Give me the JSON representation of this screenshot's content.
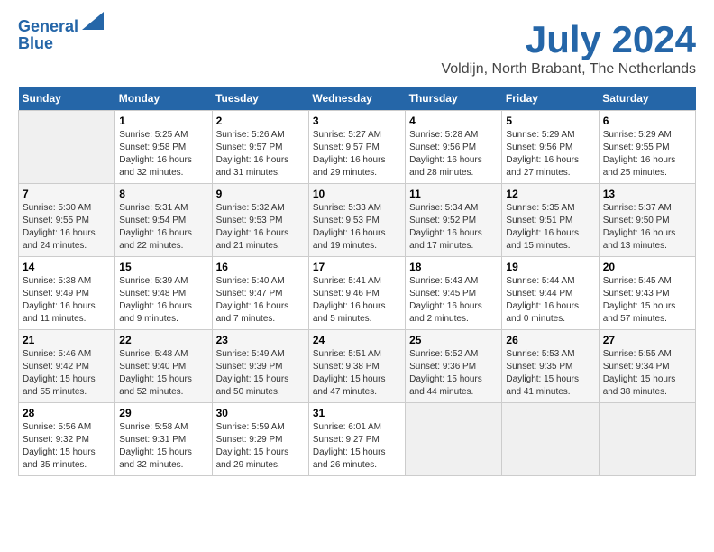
{
  "header": {
    "logo_line1": "General",
    "logo_line2": "Blue",
    "month_title": "July 2024",
    "location": "Voldijn, North Brabant, The Netherlands"
  },
  "calendar": {
    "days_of_week": [
      "Sunday",
      "Monday",
      "Tuesday",
      "Wednesday",
      "Thursday",
      "Friday",
      "Saturday"
    ],
    "weeks": [
      [
        {
          "day": "",
          "info": ""
        },
        {
          "day": "1",
          "info": "Sunrise: 5:25 AM\nSunset: 9:58 PM\nDaylight: 16 hours\nand 32 minutes."
        },
        {
          "day": "2",
          "info": "Sunrise: 5:26 AM\nSunset: 9:57 PM\nDaylight: 16 hours\nand 31 minutes."
        },
        {
          "day": "3",
          "info": "Sunrise: 5:27 AM\nSunset: 9:57 PM\nDaylight: 16 hours\nand 29 minutes."
        },
        {
          "day": "4",
          "info": "Sunrise: 5:28 AM\nSunset: 9:56 PM\nDaylight: 16 hours\nand 28 minutes."
        },
        {
          "day": "5",
          "info": "Sunrise: 5:29 AM\nSunset: 9:56 PM\nDaylight: 16 hours\nand 27 minutes."
        },
        {
          "day": "6",
          "info": "Sunrise: 5:29 AM\nSunset: 9:55 PM\nDaylight: 16 hours\nand 25 minutes."
        }
      ],
      [
        {
          "day": "7",
          "info": "Sunrise: 5:30 AM\nSunset: 9:55 PM\nDaylight: 16 hours\nand 24 minutes."
        },
        {
          "day": "8",
          "info": "Sunrise: 5:31 AM\nSunset: 9:54 PM\nDaylight: 16 hours\nand 22 minutes."
        },
        {
          "day": "9",
          "info": "Sunrise: 5:32 AM\nSunset: 9:53 PM\nDaylight: 16 hours\nand 21 minutes."
        },
        {
          "day": "10",
          "info": "Sunrise: 5:33 AM\nSunset: 9:53 PM\nDaylight: 16 hours\nand 19 minutes."
        },
        {
          "day": "11",
          "info": "Sunrise: 5:34 AM\nSunset: 9:52 PM\nDaylight: 16 hours\nand 17 minutes."
        },
        {
          "day": "12",
          "info": "Sunrise: 5:35 AM\nSunset: 9:51 PM\nDaylight: 16 hours\nand 15 minutes."
        },
        {
          "day": "13",
          "info": "Sunrise: 5:37 AM\nSunset: 9:50 PM\nDaylight: 16 hours\nand 13 minutes."
        }
      ],
      [
        {
          "day": "14",
          "info": "Sunrise: 5:38 AM\nSunset: 9:49 PM\nDaylight: 16 hours\nand 11 minutes."
        },
        {
          "day": "15",
          "info": "Sunrise: 5:39 AM\nSunset: 9:48 PM\nDaylight: 16 hours\nand 9 minutes."
        },
        {
          "day": "16",
          "info": "Sunrise: 5:40 AM\nSunset: 9:47 PM\nDaylight: 16 hours\nand 7 minutes."
        },
        {
          "day": "17",
          "info": "Sunrise: 5:41 AM\nSunset: 9:46 PM\nDaylight: 16 hours\nand 5 minutes."
        },
        {
          "day": "18",
          "info": "Sunrise: 5:43 AM\nSunset: 9:45 PM\nDaylight: 16 hours\nand 2 minutes."
        },
        {
          "day": "19",
          "info": "Sunrise: 5:44 AM\nSunset: 9:44 PM\nDaylight: 16 hours\nand 0 minutes."
        },
        {
          "day": "20",
          "info": "Sunrise: 5:45 AM\nSunset: 9:43 PM\nDaylight: 15 hours\nand 57 minutes."
        }
      ],
      [
        {
          "day": "21",
          "info": "Sunrise: 5:46 AM\nSunset: 9:42 PM\nDaylight: 15 hours\nand 55 minutes."
        },
        {
          "day": "22",
          "info": "Sunrise: 5:48 AM\nSunset: 9:40 PM\nDaylight: 15 hours\nand 52 minutes."
        },
        {
          "day": "23",
          "info": "Sunrise: 5:49 AM\nSunset: 9:39 PM\nDaylight: 15 hours\nand 50 minutes."
        },
        {
          "day": "24",
          "info": "Sunrise: 5:51 AM\nSunset: 9:38 PM\nDaylight: 15 hours\nand 47 minutes."
        },
        {
          "day": "25",
          "info": "Sunrise: 5:52 AM\nSunset: 9:36 PM\nDaylight: 15 hours\nand 44 minutes."
        },
        {
          "day": "26",
          "info": "Sunrise: 5:53 AM\nSunset: 9:35 PM\nDaylight: 15 hours\nand 41 minutes."
        },
        {
          "day": "27",
          "info": "Sunrise: 5:55 AM\nSunset: 9:34 PM\nDaylight: 15 hours\nand 38 minutes."
        }
      ],
      [
        {
          "day": "28",
          "info": "Sunrise: 5:56 AM\nSunset: 9:32 PM\nDaylight: 15 hours\nand 35 minutes."
        },
        {
          "day": "29",
          "info": "Sunrise: 5:58 AM\nSunset: 9:31 PM\nDaylight: 15 hours\nand 32 minutes."
        },
        {
          "day": "30",
          "info": "Sunrise: 5:59 AM\nSunset: 9:29 PM\nDaylight: 15 hours\nand 29 minutes."
        },
        {
          "day": "31",
          "info": "Sunrise: 6:01 AM\nSunset: 9:27 PM\nDaylight: 15 hours\nand 26 minutes."
        },
        {
          "day": "",
          "info": ""
        },
        {
          "day": "",
          "info": ""
        },
        {
          "day": "",
          "info": ""
        }
      ]
    ]
  }
}
